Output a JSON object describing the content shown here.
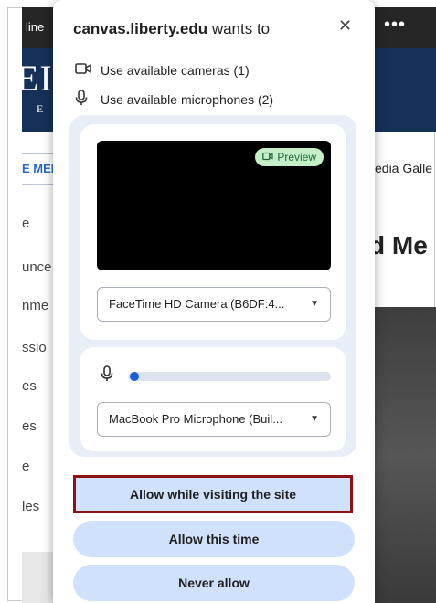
{
  "background_page": {
    "topbar_text": "line",
    "menu_icon": "more-horizontal-icon",
    "logo_big": "EI",
    "logo_small": "E R",
    "menu_tab": "E MEN",
    "left_items": [
      "e",
      "unce",
      "nme",
      "ssio",
      "es",
      "es",
      "e",
      "les"
    ],
    "right_gallery": "edia Galle",
    "right_heading": "d Me"
  },
  "popup": {
    "site": "canvas.liberty.edu",
    "title_suffix": " wants to",
    "close_icon": "close-icon",
    "permissions": [
      {
        "icon": "camera-icon",
        "label": "Use available cameras (1)"
      },
      {
        "icon": "microphone-icon",
        "label": "Use available microphones (2)"
      }
    ],
    "preview_label": "Preview",
    "camera_select": "FaceTime HD Camera (B6DF:4...",
    "microphone_level": 0.03,
    "microphone_select": "MacBook Pro Microphone (Buil...",
    "buttons": {
      "allow_visit": "Allow while visiting the site",
      "allow_once": "Allow this time",
      "never": "Never allow"
    },
    "colors": {
      "button_bg": "#cfe1fb",
      "highlight_border": "#8c1111",
      "panel_bg": "#e8eef8",
      "mic_level": "#1a5fd6"
    }
  }
}
